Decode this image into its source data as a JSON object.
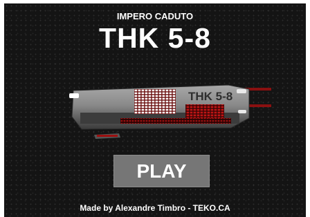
{
  "game": {
    "subtitle": "IMPERO CADUTO",
    "title": "THK 5-8",
    "ship_label": "THK 5-8",
    "play_label": "PLAY",
    "credit": "Made by Alexandre Timbro - TEKO.CA"
  }
}
